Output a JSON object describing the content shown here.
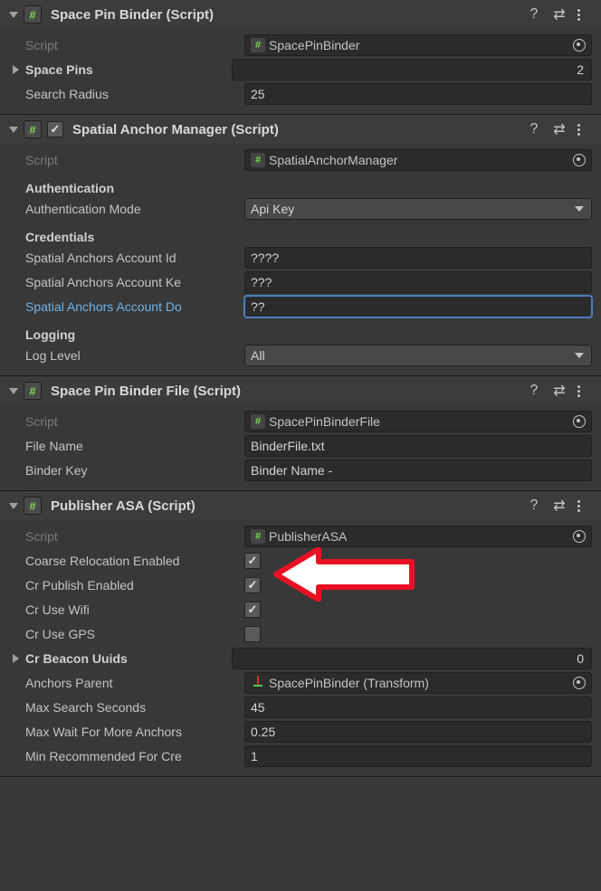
{
  "components": {
    "spacePinBinder": {
      "title": "Space Pin Binder (Script)",
      "scriptLabel": "Script",
      "scriptValue": "SpacePinBinder",
      "spacePinsLabel": "Space Pins",
      "spacePinsCount": "2",
      "searchRadiusLabel": "Search Radius",
      "searchRadiusValue": "25"
    },
    "spatialAnchorManager": {
      "title": "Spatial Anchor Manager (Script)",
      "enabled": true,
      "scriptLabel": "Script",
      "scriptValue": "SpatialAnchorManager",
      "authHeader": "Authentication",
      "authModeLabel": "Authentication Mode",
      "authModeValue": "Api Key",
      "credHeader": "Credentials",
      "acctIdLabel": "Spatial Anchors Account Id",
      "acctIdValue": "????",
      "acctKeyLabel": "Spatial Anchors Account Ke",
      "acctKeyValue": "???",
      "acctDomLabel": "Spatial Anchors Account Do",
      "acctDomValue": "??",
      "logHeader": "Logging",
      "logLevelLabel": "Log Level",
      "logLevelValue": "All"
    },
    "spacePinBinderFile": {
      "title": "Space Pin Binder File (Script)",
      "scriptLabel": "Script",
      "scriptValue": "SpacePinBinderFile",
      "fileNameLabel": "File Name",
      "fileNameValue": "BinderFile.txt",
      "binderKeyLabel": "Binder Key",
      "binderKeyValue": "Binder Name -"
    },
    "publisherASA": {
      "title": "Publisher ASA (Script)",
      "scriptLabel": "Script",
      "scriptValue": "PublisherASA",
      "coarseRelocLabel": "Coarse Relocation Enabled",
      "coarseReloc": true,
      "crPublishLabel": "Cr Publish Enabled",
      "crPublish": true,
      "crWifiLabel": "Cr Use Wifi",
      "crWifi": true,
      "crGpsLabel": "Cr Use GPS",
      "crGps": false,
      "beaconLabel": "Cr Beacon Uuids",
      "beaconCount": "0",
      "anchorsParentLabel": "Anchors Parent",
      "anchorsParentValue": "SpacePinBinder (Transform)",
      "maxSearchLabel": "Max Search Seconds",
      "maxSearchValue": "45",
      "maxWaitLabel": "Max Wait For More Anchors",
      "maxWaitValue": "0.25",
      "minRecLabel": "Min Recommended For Cre",
      "minRecValue": "1"
    }
  }
}
